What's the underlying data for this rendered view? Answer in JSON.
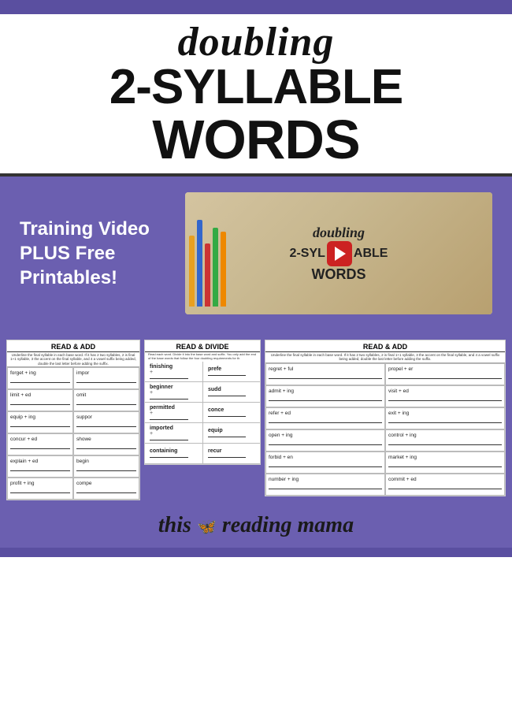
{
  "page": {
    "top_strip_color": "#5a4fa0",
    "bg_purple": "#6b5fb0"
  },
  "title": {
    "doubling": "doubling",
    "syllable": "2-SYLLABLE",
    "words": "WORDS"
  },
  "promo": {
    "text": "Training Video PLUS Free Printables!"
  },
  "video": {
    "doubling": "doubling",
    "syllable_prefix": "2-SYL",
    "syllable_suffix": "ABLE",
    "words": "WORDS"
  },
  "worksheet_left": {
    "header": "READ & ADD",
    "subtext": "Underline the final syllable in each base word. If it has 2 two syllables, 2 is final 1+1 syllable, 3 the accent on the final syllable, and 4 a vowel suffix being added, double the last letter before adding the suffix.",
    "rows": [
      {
        "left": "forget + ing",
        "right": "impor"
      },
      {
        "left": "limit + ed",
        "right": "omit"
      },
      {
        "left": "equip + ing",
        "right": "suppor"
      },
      {
        "left": "concur + ed",
        "right": "showe"
      },
      {
        "left": "explain + ed",
        "right": "begin"
      },
      {
        "left": "profit + ing",
        "right": "compe"
      }
    ]
  },
  "worksheet_center": {
    "header": "READ & DIVIDE",
    "subtext": "Read each word. Divide it into the base word and suffix. You only add the end of the base words that follow the four doubling requirements for th",
    "rows": [
      {
        "word": "finishing",
        "plus": "+"
      },
      {
        "word": "beginner",
        "plus": "+"
      },
      {
        "word": "permitted",
        "plus": "+"
      },
      {
        "word": "imported",
        "plus": "+"
      },
      {
        "word": "containing",
        "plus": ""
      }
    ],
    "right_col": [
      "prefe",
      "sudd",
      "conce",
      "equip",
      "recur"
    ]
  },
  "worksheet_right": {
    "header": "READ & ADD",
    "subtext": "Underline the final syllable in each base word. If it has 2 two syllables, 2 is final 1+1 syllable, 3 the accent on the final syllable, and 4 a vowel suffix being added, double the last letter before adding the suffix.",
    "rows": [
      {
        "left": "regret + ful",
        "right": "propel + er"
      },
      {
        "left": "admit + ing",
        "right": "visit + ed"
      },
      {
        "left": "refer + ed",
        "right": "exit  + ing"
      },
      {
        "left": "open + ing",
        "right": "control + ing"
      },
      {
        "left": "forbid + en",
        "right": "market + ing"
      },
      {
        "left": "number + ing",
        "right": "commit + ed"
      }
    ]
  },
  "logo": {
    "text": "this reading mama",
    "butterfly": "🦋"
  }
}
